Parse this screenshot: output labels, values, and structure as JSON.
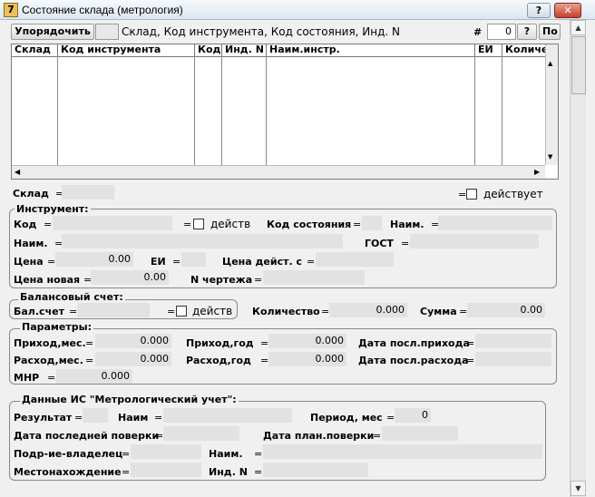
{
  "window": {
    "title": "Состояние склада (метрология)",
    "help_btn": "?",
    "min_btn": "–",
    "close_btn": "✕"
  },
  "sort": {
    "button": "Упорядочить",
    "order": "Склад, Код инструмента, Код состояния, Инд. N",
    "hash": "#",
    "count": "0",
    "help": "?",
    "extra_btn": "По"
  },
  "grid": {
    "columns": [
      "Склад",
      "Код инструмента",
      "Код",
      "Инд. N",
      "Наим.инстр.",
      "ЕИ",
      "Количе"
    ]
  },
  "sklad": {
    "label": "Склад",
    "eq": "=",
    "active_label": "действует"
  },
  "instrument": {
    "title": "Инструмент:",
    "kod": "Код",
    "deistv": "действ",
    "kod_sost": "Код состояния",
    "naim": "Наим.",
    "naim2": "Наим.",
    "gost": "ГОСТ",
    "cena": "Цена",
    "cena_val": "0.00",
    "ei": "ЕИ",
    "cena_deist": "Цена дейст. с",
    "cena_new": "Цена новая",
    "cena_new_val": "0.00",
    "n_chert": "N чертежа"
  },
  "balance": {
    "title": "Балансовый счет:",
    "bal": "Бал.счет",
    "deistv": "действ",
    "kol": "Количество",
    "kol_val": "0.000",
    "summa": "Сумма",
    "summa_val": "0.00"
  },
  "params": {
    "title": "Параметры:",
    "prih_mes": "Приход,мес.",
    "prih_mes_val": "0.000",
    "prih_god": "Приход,год",
    "prih_god_val": "0.000",
    "date_prih": "Дата посл.прихода",
    "rash_mes": "Расход,мес.",
    "rash_mes_val": "0.000",
    "rash_god": "Расход,год",
    "rash_god_val": "0.000",
    "date_rash": "Дата посл.расхода",
    "mnr": "МНР",
    "mnr_val": "0.000"
  },
  "metro": {
    "title": "Данные ИС \"Метрологический учет\":",
    "result": "Результат",
    "naim": "Наим",
    "period": "Период, мес",
    "period_val": "0",
    "last_check": "Дата последней поверки",
    "plan_check": "Дата план.поверки",
    "owner": "Подр-ие-владелец",
    "naim2": "Наим.",
    "location": "Местонахождение",
    "ind": "Инд. N"
  },
  "eq": "="
}
